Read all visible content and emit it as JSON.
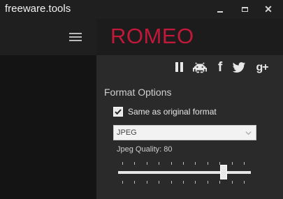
{
  "window": {
    "title": "freeware.tools",
    "minimize_icon": "minimize-icon",
    "maximize_icon": "maximize-icon",
    "close_icon": "close-icon",
    "close_glyph": "✕"
  },
  "sidebar": {
    "menu_icon": "hamburger-menu-icon"
  },
  "header": {
    "brand": "ROMEO",
    "brand_color": "#c2183a",
    "icons": [
      "pause-icon",
      "space-invader-icon",
      "facebook-icon",
      "twitter-icon",
      "google-plus-icon"
    ],
    "facebook_glyph": "f",
    "google_plus_glyph": "g+"
  },
  "format_options": {
    "title": "Format Options",
    "same_as_original": {
      "label": "Same as original format",
      "checked": true
    },
    "format_select": {
      "value": "JPEG"
    },
    "jpeg_quality": {
      "label": "Jpeg Quality: 80",
      "value": 80,
      "min": 0,
      "max": 100
    }
  }
}
